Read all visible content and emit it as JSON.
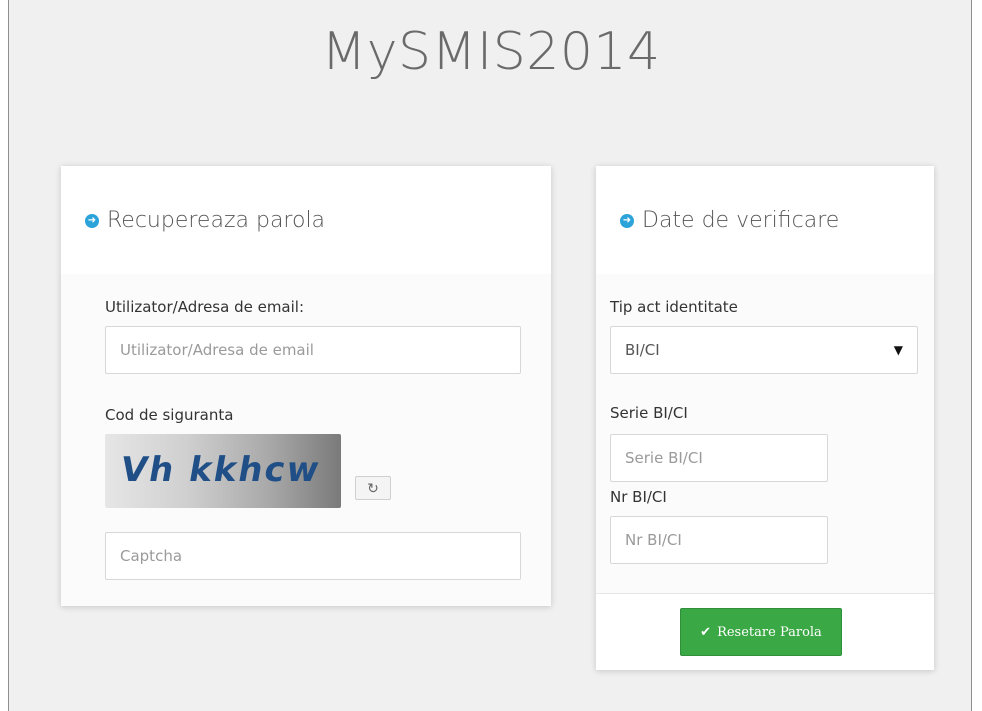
{
  "app": {
    "title": "MySMIS2014"
  },
  "left_panel": {
    "title": "Recupereaza parola",
    "title_icon": "circle-arrow-right-icon",
    "fields": {
      "user_label": "Utilizator/Adresa de email:",
      "user_placeholder": "Utilizator/Adresa de email",
      "captcha_label": "Cod de siguranta",
      "captcha_text": "Vh kkhcw",
      "captcha_refresh_icon": "refresh-icon",
      "captcha_refresh_glyph": "↻",
      "captcha_placeholder": "Captcha"
    }
  },
  "right_panel": {
    "title": "Date de verificare",
    "title_icon": "circle-arrow-right-icon",
    "fields": {
      "id_type_label": "Tip act identitate",
      "id_type_selected": "BI/CI",
      "id_type_caret_glyph": "▼",
      "serie_label": "Serie BI/CI",
      "serie_placeholder": "Serie BI/CI",
      "nr_label": "Nr BI/CI",
      "nr_placeholder": "Nr BI/CI"
    },
    "footer": {
      "reset_button_label": "Resetare Parola",
      "reset_button_icon": "checkmark-icon",
      "reset_button_glyph": "✔",
      "reset_button_color": "#3aa845"
    }
  },
  "colors": {
    "accent": "#2ca3d9",
    "button_green": "#3aa845"
  }
}
